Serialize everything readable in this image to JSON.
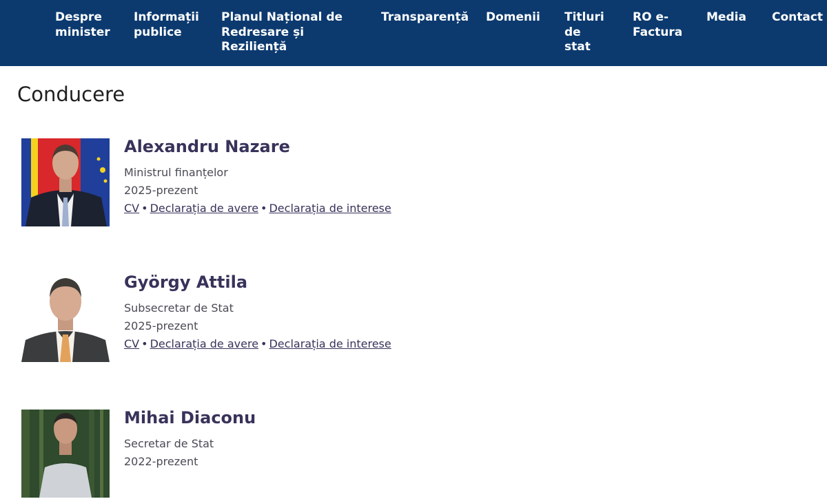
{
  "nav": {
    "items": [
      {
        "label": "Despre\nminister"
      },
      {
        "label": "Informații\npublice"
      },
      {
        "label": "Planul Național de\nRedresare și\nReziliență"
      },
      {
        "label": "Transparență"
      },
      {
        "label": "Domenii"
      },
      {
        "label": "Titluri\nde\nstat"
      },
      {
        "label": "RO e-\nFactura"
      },
      {
        "label": "Media"
      },
      {
        "label": "Contact"
      }
    ]
  },
  "page": {
    "title": "Conducere"
  },
  "people": [
    {
      "name": "Alexandru Nazare",
      "role": "Ministrul finanțelor",
      "term": "2025-prezent",
      "links": {
        "cv": "CV",
        "avere": "Declarația de avere",
        "interese": "Declarația de interese"
      },
      "separator": "•"
    },
    {
      "name": "György Attila",
      "role": "Subsecretar de Stat",
      "term": "2025-prezent",
      "links": {
        "cv": "CV",
        "avere": "Declarația de avere",
        "interese": "Declarația de interese"
      },
      "separator": "•"
    },
    {
      "name": "Mihai Diaconu",
      "role": "Secretar de Stat",
      "term": "2022-prezent"
    }
  ],
  "colors": {
    "nav_background": "#0c3a6f",
    "nav_text": "#ffffff",
    "name_text": "#37335a",
    "body_text": "#4a4a55"
  }
}
